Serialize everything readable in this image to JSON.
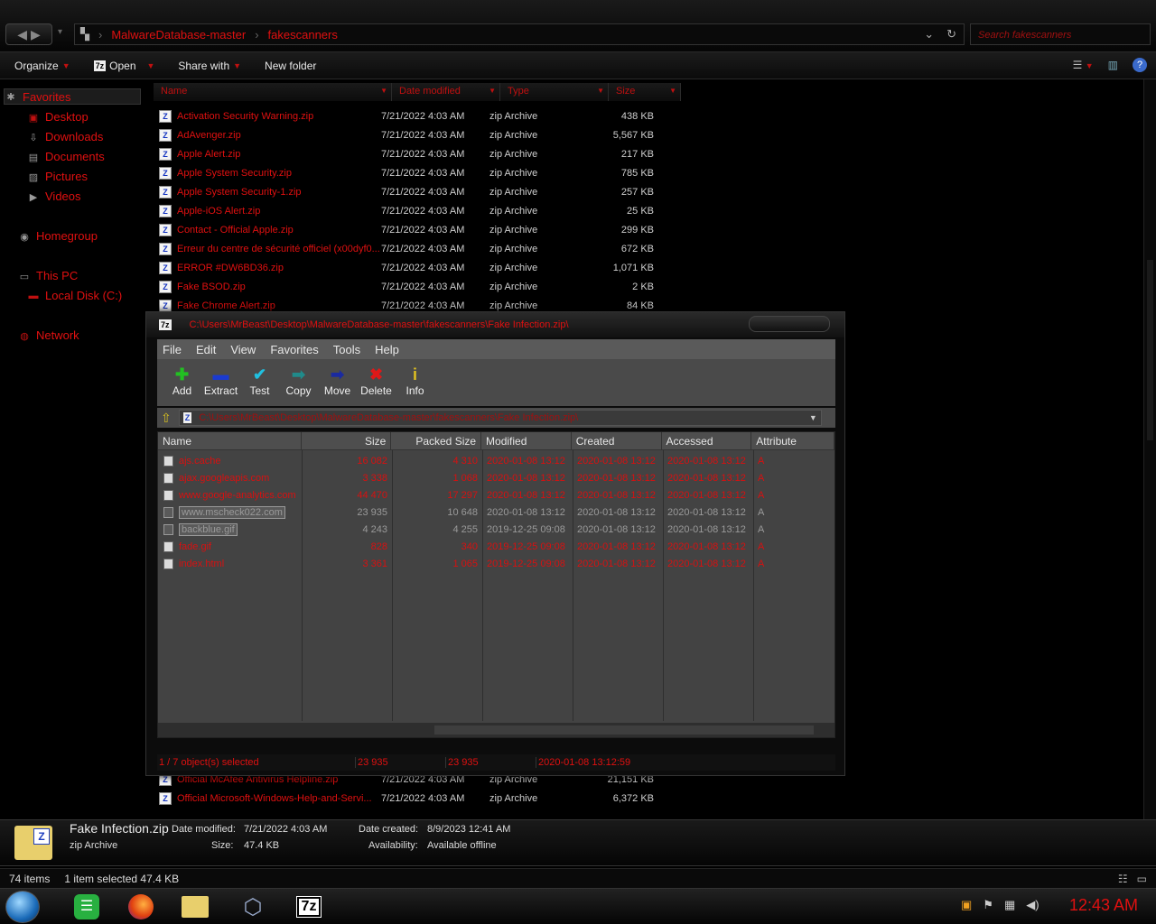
{
  "explorer": {
    "breadcrumb": [
      "MalwareDatabase-master",
      "fakescanners"
    ],
    "search_placeholder": "Search fakescanners",
    "toolbar": {
      "organize": "Organize",
      "open": "Open",
      "share_with": "Share with",
      "new_folder": "New folder"
    },
    "nav": {
      "favorites": "Favorites",
      "desktop": "Desktop",
      "downloads": "Downloads",
      "documents": "Documents",
      "pictures": "Pictures",
      "videos": "Videos",
      "homegroup": "Homegroup",
      "this_pc": "This PC",
      "local_disk": "Local Disk (C:)",
      "network": "Network"
    },
    "columns": {
      "name": "Name",
      "date": "Date modified",
      "type": "Type",
      "size": "Size"
    },
    "files": [
      {
        "name": "Activation Security Warning.zip",
        "date": "7/21/2022 4:03 AM",
        "type": "zip Archive",
        "size": "438 KB"
      },
      {
        "name": "AdAvenger.zip",
        "date": "7/21/2022 4:03 AM",
        "type": "zip Archive",
        "size": "5,567 KB"
      },
      {
        "name": "Apple Alert.zip",
        "date": "7/21/2022 4:03 AM",
        "type": "zip Archive",
        "size": "217 KB"
      },
      {
        "name": "Apple System Security.zip",
        "date": "7/21/2022 4:03 AM",
        "type": "zip Archive",
        "size": "785 KB"
      },
      {
        "name": "Apple System Security-1.zip",
        "date": "7/21/2022 4:03 AM",
        "type": "zip Archive",
        "size": "257 KB"
      },
      {
        "name": "Apple-iOS Alert.zip",
        "date": "7/21/2022 4:03 AM",
        "type": "zip Archive",
        "size": "25 KB"
      },
      {
        "name": "Contact - Official Apple.zip",
        "date": "7/21/2022 4:03 AM",
        "type": "zip Archive",
        "size": "299 KB"
      },
      {
        "name": "Erreur du centre de sécurité officiel (x00dyf0...",
        "date": "7/21/2022 4:03 AM",
        "type": "zip Archive",
        "size": "672 KB"
      },
      {
        "name": "ERROR #DW6BD36.zip",
        "date": "7/21/2022 4:03 AM",
        "type": "zip Archive",
        "size": "1,071 KB"
      },
      {
        "name": "Fake BSOD.zip",
        "date": "7/21/2022 4:03 AM",
        "type": "zip Archive",
        "size": "2 KB"
      },
      {
        "name": "Fake Chrome Alert.zip",
        "date": "7/21/2022 4:03 AM",
        "type": "zip Archive",
        "size": "84 KB"
      }
    ],
    "files_below": [
      {
        "name": "Official McAfee Antivirus Helpline.zip",
        "date": "7/21/2022 4:03 AM",
        "type": "zip Archive",
        "size": "21,151 KB"
      },
      {
        "name": "Official Microsoft-Windows-Help-and-Servi...",
        "date": "7/21/2022 4:03 AM",
        "type": "zip Archive",
        "size": "6,372 KB"
      }
    ],
    "details": {
      "filename": "Fake Infection.zip",
      "type": "zip Archive",
      "date_modified_label": "Date modified:",
      "date_modified": "7/21/2022 4:03 AM",
      "size_label": "Size:",
      "size": "47.4 KB",
      "date_created_label": "Date created:",
      "date_created": "8/9/2023 12:41 AM",
      "availability_label": "Availability:",
      "availability": "Available offline"
    },
    "status": {
      "items": "74 items",
      "selected": "1 item selected  47.4 KB"
    }
  },
  "sevenzip": {
    "title_path": "C:\\Users\\MrBeast\\Desktop\\MalwareDatabase-master\\fakescanners\\Fake Infection.zip\\",
    "menu": [
      "File",
      "Edit",
      "View",
      "Favorites",
      "Tools",
      "Help"
    ],
    "tools": [
      {
        "label": "Add",
        "icon": "plus-icon",
        "glyph": "✚",
        "color": "#22c022"
      },
      {
        "label": "Extract",
        "icon": "minus-icon",
        "glyph": "▬",
        "color": "#1a3ad0"
      },
      {
        "label": "Test",
        "icon": "check-icon",
        "glyph": "✔",
        "color": "#20c0e0"
      },
      {
        "label": "Copy",
        "icon": "copy-arrow-icon",
        "glyph": "➡",
        "color": "#208a8a"
      },
      {
        "label": "Move",
        "icon": "move-arrow-icon",
        "glyph": "➡",
        "color": "#1a2aa0"
      },
      {
        "label": "Delete",
        "icon": "delete-x-icon",
        "glyph": "✖",
        "color": "#e01818"
      },
      {
        "label": "Info",
        "icon": "info-icon",
        "glyph": "i",
        "color": "#e0c020"
      }
    ],
    "address": "C:\\Users\\MrBeast\\Desktop\\MalwareDatabase-master\\fakescanners\\Fake Infection.zip\\",
    "columns": [
      "Name",
      "Size",
      "Packed Size",
      "Modified",
      "Created",
      "Accessed",
      "Attribute"
    ],
    "rows": [
      {
        "name": "ajs.cache",
        "size": "16 082",
        "packed": "4 310",
        "modified": "2020-01-08 13:12",
        "created": "2020-01-08 13:12",
        "accessed": "2020-01-08 13:12",
        "attr": "A",
        "style": "red"
      },
      {
        "name": "ajax.googleapis.com",
        "size": "3 338",
        "packed": "1 068",
        "modified": "2020-01-08 13:12",
        "created": "2020-01-08 13:12",
        "accessed": "2020-01-08 13:12",
        "attr": "A",
        "style": "red"
      },
      {
        "name": "www.google-analytics.com",
        "size": "44 470",
        "packed": "17 297",
        "modified": "2020-01-08 13:12",
        "created": "2020-01-08 13:12",
        "accessed": "2020-01-08 13:12",
        "attr": "A",
        "style": "red"
      },
      {
        "name": "www.mscheck022.com",
        "size": "23 935",
        "packed": "10 648",
        "modified": "2020-01-08 13:12",
        "created": "2020-01-08 13:12",
        "accessed": "2020-01-08 13:12",
        "attr": "A",
        "style": "gray sel"
      },
      {
        "name": "backblue.gif",
        "size": "4 243",
        "packed": "4 255",
        "modified": "2019-12-25 09:08",
        "created": "2020-01-08 13:12",
        "accessed": "2020-01-08 13:12",
        "attr": "A",
        "style": "gray sel"
      },
      {
        "name": "fade.gif",
        "size": "828",
        "packed": "340",
        "modified": "2019-12-25 09:08",
        "created": "2020-01-08 13:12",
        "accessed": "2020-01-08 13:12",
        "attr": "A",
        "style": "red"
      },
      {
        "name": "index.html",
        "size": "3 361",
        "packed": "1 065",
        "modified": "2019-12-25 09:08",
        "created": "2020-01-08 13:12",
        "accessed": "2020-01-08 13:12",
        "attr": "A",
        "style": "red"
      }
    ],
    "status": {
      "selected": "1 / 7 object(s) selected",
      "size": "23 935",
      "packed": "23 935",
      "date": "2020-01-08 13:12:59"
    }
  },
  "taskbar": {
    "clock": "12:43 AM",
    "7z_label": "7z"
  }
}
